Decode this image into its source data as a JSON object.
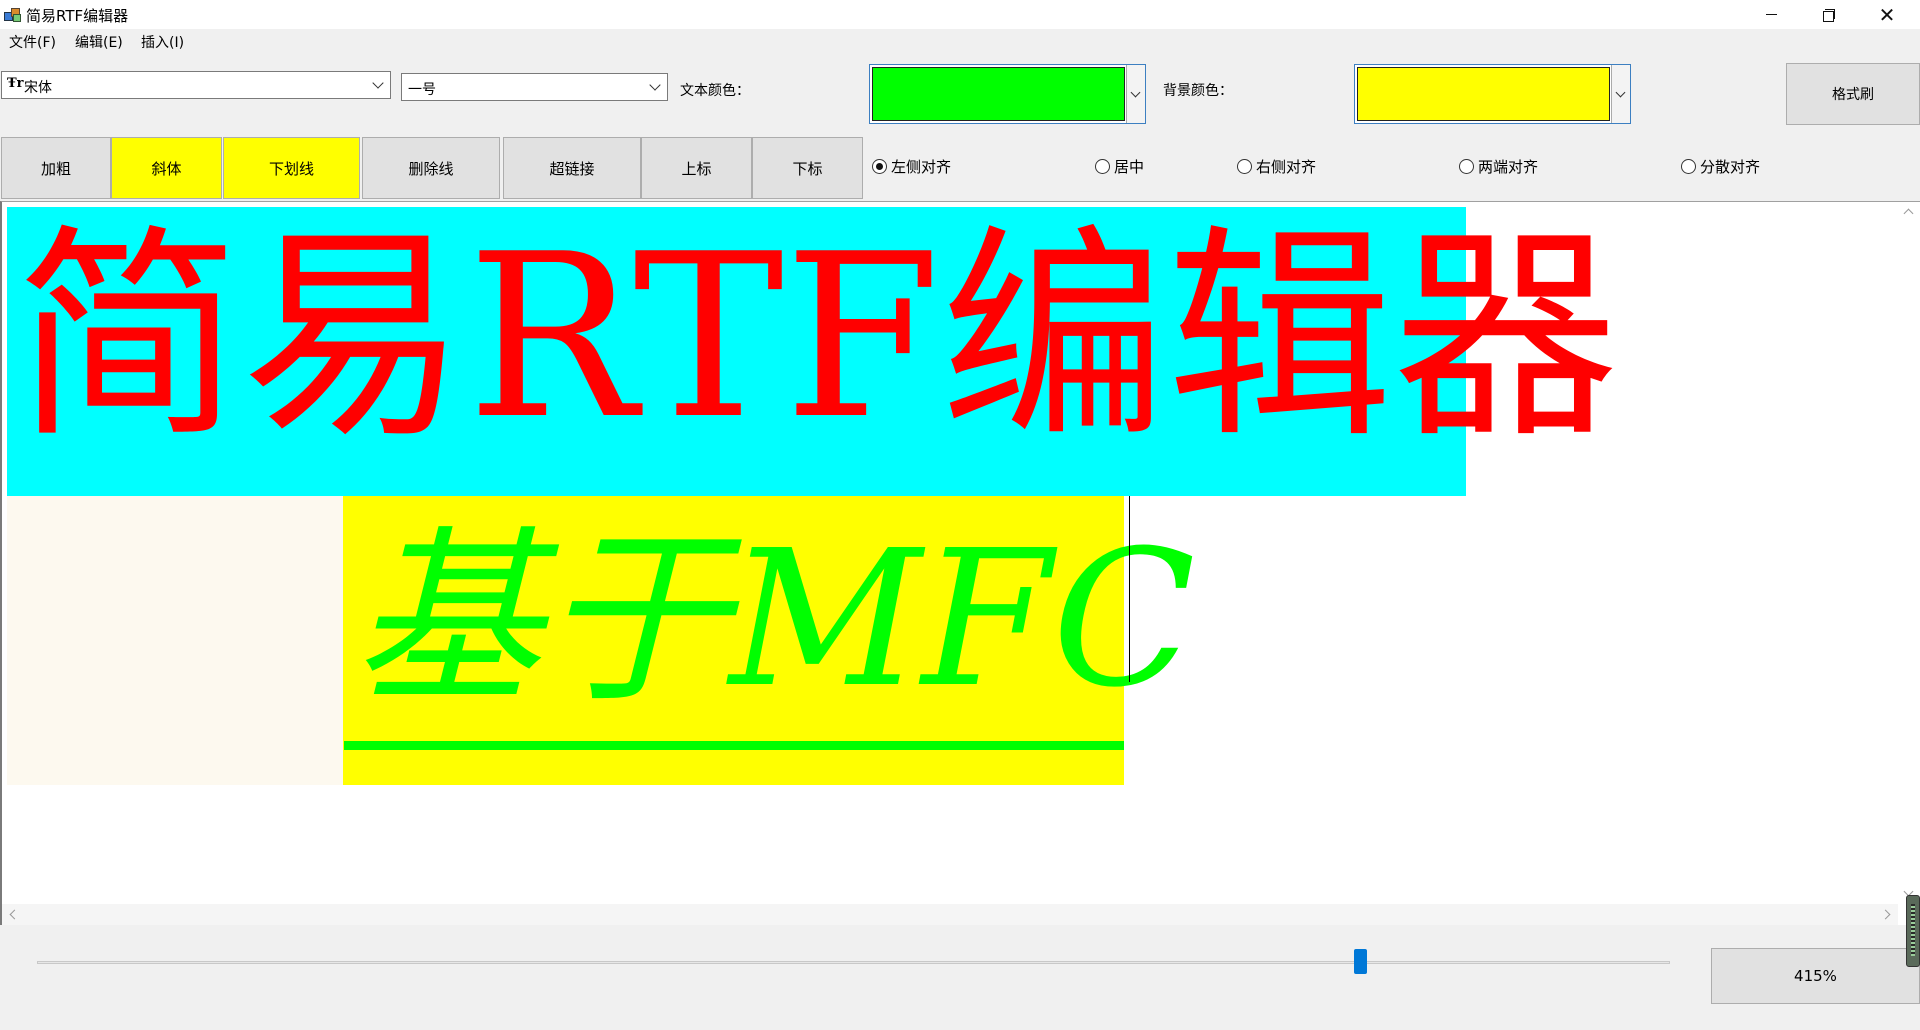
{
  "window": {
    "title": "简易RTF编辑器"
  },
  "menu": [
    "文件(F)",
    "编辑(E)",
    "插入(I)"
  ],
  "toolbar": {
    "font_name": "宋体",
    "font_icon": "Ŧr",
    "font_size": "一号",
    "text_color_label": "文本颜色：",
    "text_color": "#00ff00",
    "bg_color_label": "背景颜色：",
    "bg_color": "#ffff00",
    "format_painter": "格式刷"
  },
  "format_buttons": [
    "加粗",
    "斜体",
    "下划线",
    "删除线",
    "超链接",
    "上标",
    "下标"
  ],
  "align_options": [
    "左侧对齐",
    "居中",
    "右侧对齐",
    "两端对齐",
    "分散对齐"
  ],
  "align_selected": "左侧对齐",
  "document": {
    "line1": {
      "text": "简易RTF编辑器",
      "color": "#ff0000",
      "background": "#00ffff"
    },
    "line2": {
      "text": "基于MFC",
      "color": "#00ff00",
      "background": "#ffff00",
      "italic": true,
      "underline": true
    }
  },
  "zoom": {
    "label": "415%",
    "slider_fraction": 0.81
  }
}
